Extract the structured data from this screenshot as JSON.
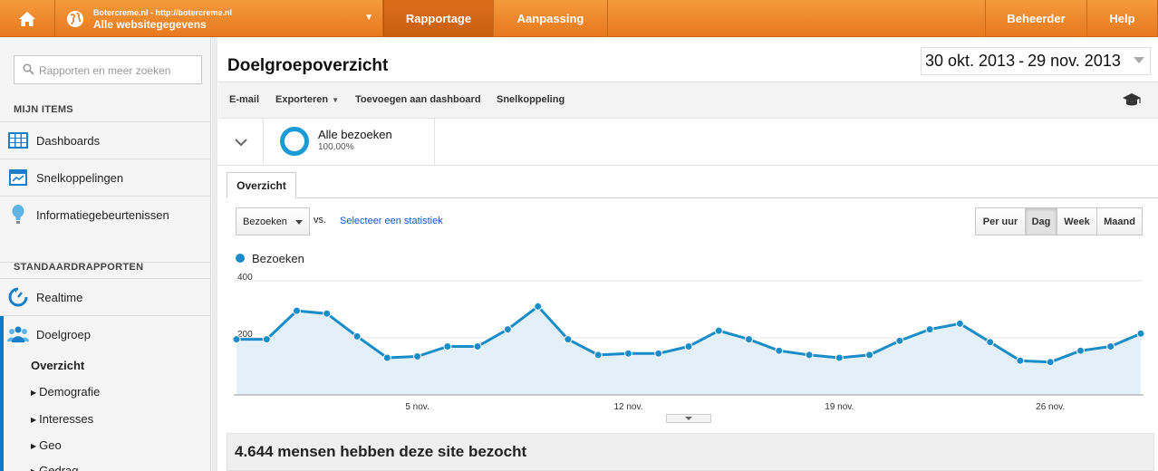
{
  "topbar": {
    "account_line1": "Botercreme.nl - http://botercreme.nl",
    "account_line2": "Alle websitegegevens",
    "tabs": {
      "rapportage": "Rapportage",
      "aanpassing": "Aanpassing",
      "beheerder": "Beheerder",
      "help": "Help"
    },
    "icons": [
      "home-icon",
      "globe-icon",
      "caret-down-icon"
    ]
  },
  "sidebar": {
    "search_placeholder": "Rapporten en meer zoeken",
    "mijn_items_title": "MIJN ITEMS",
    "mijn_items": [
      {
        "label": "Dashboards",
        "icon": "dashboard-grid-icon"
      },
      {
        "label": "Snelkoppelingen",
        "icon": "shortcut-icon"
      },
      {
        "label": "Informatiegebeurtenissen",
        "icon": "lightbulb-icon"
      }
    ],
    "standaard_title": "STANDAARDRAPPORTEN",
    "standaard_items": [
      {
        "label": "Realtime",
        "icon": "realtime-icon"
      },
      {
        "label": "Doelgroep",
        "icon": "audience-icon"
      }
    ],
    "sub_items": [
      "Overzicht",
      "Demografie",
      "Interesses",
      "Geo",
      "Gedrag"
    ]
  },
  "main": {
    "title": "Doelgroepoverzicht",
    "date_start": "30 okt. 2013",
    "date_sep": "-",
    "date_end": "29 nov. 2013",
    "toolbar": {
      "email": "E-mail",
      "exporteren": "Exporteren",
      "dashboard": "Toevoegen aan dashboard",
      "snelkoppeling": "Snelkoppeling"
    },
    "segment": {
      "name": "Alle bezoeken",
      "percent": "100,00%"
    },
    "tab_overzicht": "Overzicht",
    "metric": "Bezoeken",
    "vs": "vs.",
    "select_stat": "Selecteer een statistiek",
    "periods": [
      "Per uur",
      "Dag",
      "Week",
      "Maand"
    ],
    "active_period": "Dag",
    "summary": "4.644 mensen hebben deze site bezocht"
  },
  "colors": {
    "brand_orange": "#ee8a2c",
    "line_blue": "#1a8cc8",
    "area_fill": "#e3f0f8"
  },
  "chart_data": {
    "type": "area",
    "x": [
      "30 okt.",
      "31 okt.",
      "1 nov.",
      "2 nov.",
      "3 nov.",
      "4 nov.",
      "5 nov.",
      "6 nov.",
      "7 nov.",
      "8 nov.",
      "9 nov.",
      "10 nov.",
      "11 nov.",
      "12 nov.",
      "13 nov.",
      "14 nov.",
      "15 nov.",
      "16 nov.",
      "17 nov.",
      "18 nov.",
      "19 nov.",
      "20 nov.",
      "21 nov.",
      "22 nov.",
      "23 nov.",
      "24 nov.",
      "25 nov.",
      "26 nov.",
      "27 nov.",
      "28 nov.",
      "29 nov."
    ],
    "series": [
      {
        "name": "Bezoeken",
        "values": [
          195,
          195,
          295,
          285,
          205,
          130,
          135,
          170,
          170,
          230,
          310,
          195,
          140,
          145,
          145,
          170,
          225,
          195,
          155,
          140,
          130,
          140,
          190,
          230,
          250,
          185,
          120,
          115,
          155,
          170,
          215
        ]
      }
    ],
    "ylim": [
      0,
      400
    ],
    "yticks": [
      200,
      400
    ],
    "xtick_labels": [
      "5 nov.",
      "12 nov.",
      "19 nov.",
      "26 nov."
    ],
    "legend": "top-left",
    "grid": "horizontal"
  }
}
